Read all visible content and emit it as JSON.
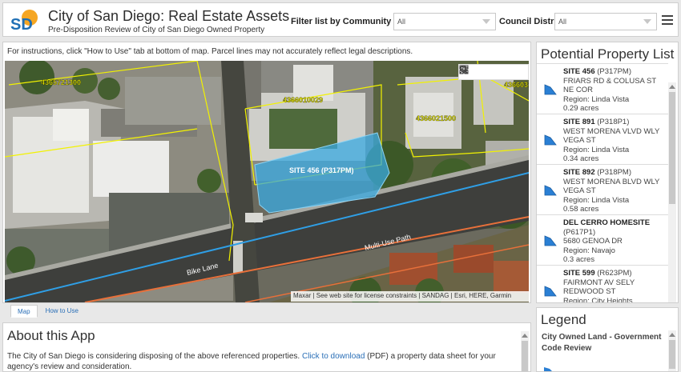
{
  "header": {
    "logo_text": "SD",
    "title": "City of San Diego: Real Estate Assets",
    "subtitle": "Pre-Disposition Review of City of San Diego Owned Property",
    "community_filter_label": "Filter list by Community Area:",
    "community_filter_value": "All",
    "council_filter_label": "Council District:",
    "council_filter_value": "All"
  },
  "map": {
    "instructions": "For instructions, click \"How to Use\" tab at bottom of map. Parcel lines may not accurately reflect legal descriptions.",
    "site_label": "SITE 456 (P317PM)",
    "parcel_labels": [
      "4365721300",
      "4366010029",
      "4366021500",
      "4366031"
    ],
    "road_labels": [
      "Bike Lane",
      "Multi-Use Path"
    ],
    "attribution": "Maxar | See web site for license constraints | SANDAG | Esri, HERE, Garmin",
    "tools": [
      "search-icon",
      "list-icon",
      "layers-icon",
      "basemap-gallery-icon"
    ]
  },
  "tabs": [
    {
      "label": "Map",
      "active": true
    },
    {
      "label": "How to Use",
      "active": false
    }
  ],
  "about": {
    "title": "About this App",
    "text_before": "The City of San Diego is considering disposing of the above referenced properties. ",
    "link_text": "Click to download",
    "text_after": " (PDF) a property data sheet for your agency's review and consideration."
  },
  "property_list": {
    "title": "Potential Property List",
    "items": [
      {
        "name": "SITE 456",
        "code": "(P317PM)",
        "address": "FRIARS RD & COLUSA ST NE COR",
        "region": "Region: Linda Vista",
        "acres": "0.29 acres"
      },
      {
        "name": "SITE 891",
        "code": "(P318P1)",
        "address": "WEST MORENA VLVD WLY VEGA ST",
        "region": "Region: Linda Vista",
        "acres": "0.34 acres"
      },
      {
        "name": "SITE 892",
        "code": "(P318PM)",
        "address": "WEST MORENA BLVD WLY VEGA ST",
        "region": "Region: Linda Vista",
        "acres": "0.58 acres"
      },
      {
        "name": "DEL CERRO HOMESITE",
        "code": "(P617P1)",
        "address": "5680 GENOA DR",
        "region": "Region: Navajo",
        "acres": "0.3 acres"
      },
      {
        "name": "SITE 599",
        "code": "(R623PM)",
        "address": "FAIRMONT AV SELY REDWOOD ST",
        "region": "Region: City Heights",
        "acres": ""
      }
    ]
  },
  "legend": {
    "title": "Legend",
    "label": "City Owned Land - Government Code Review"
  },
  "colors": {
    "accent_blue": "#2a7fd4",
    "site_fill": "#3aa9e0",
    "parcel_line": "#f2f200",
    "link": "#2a6fb7"
  }
}
